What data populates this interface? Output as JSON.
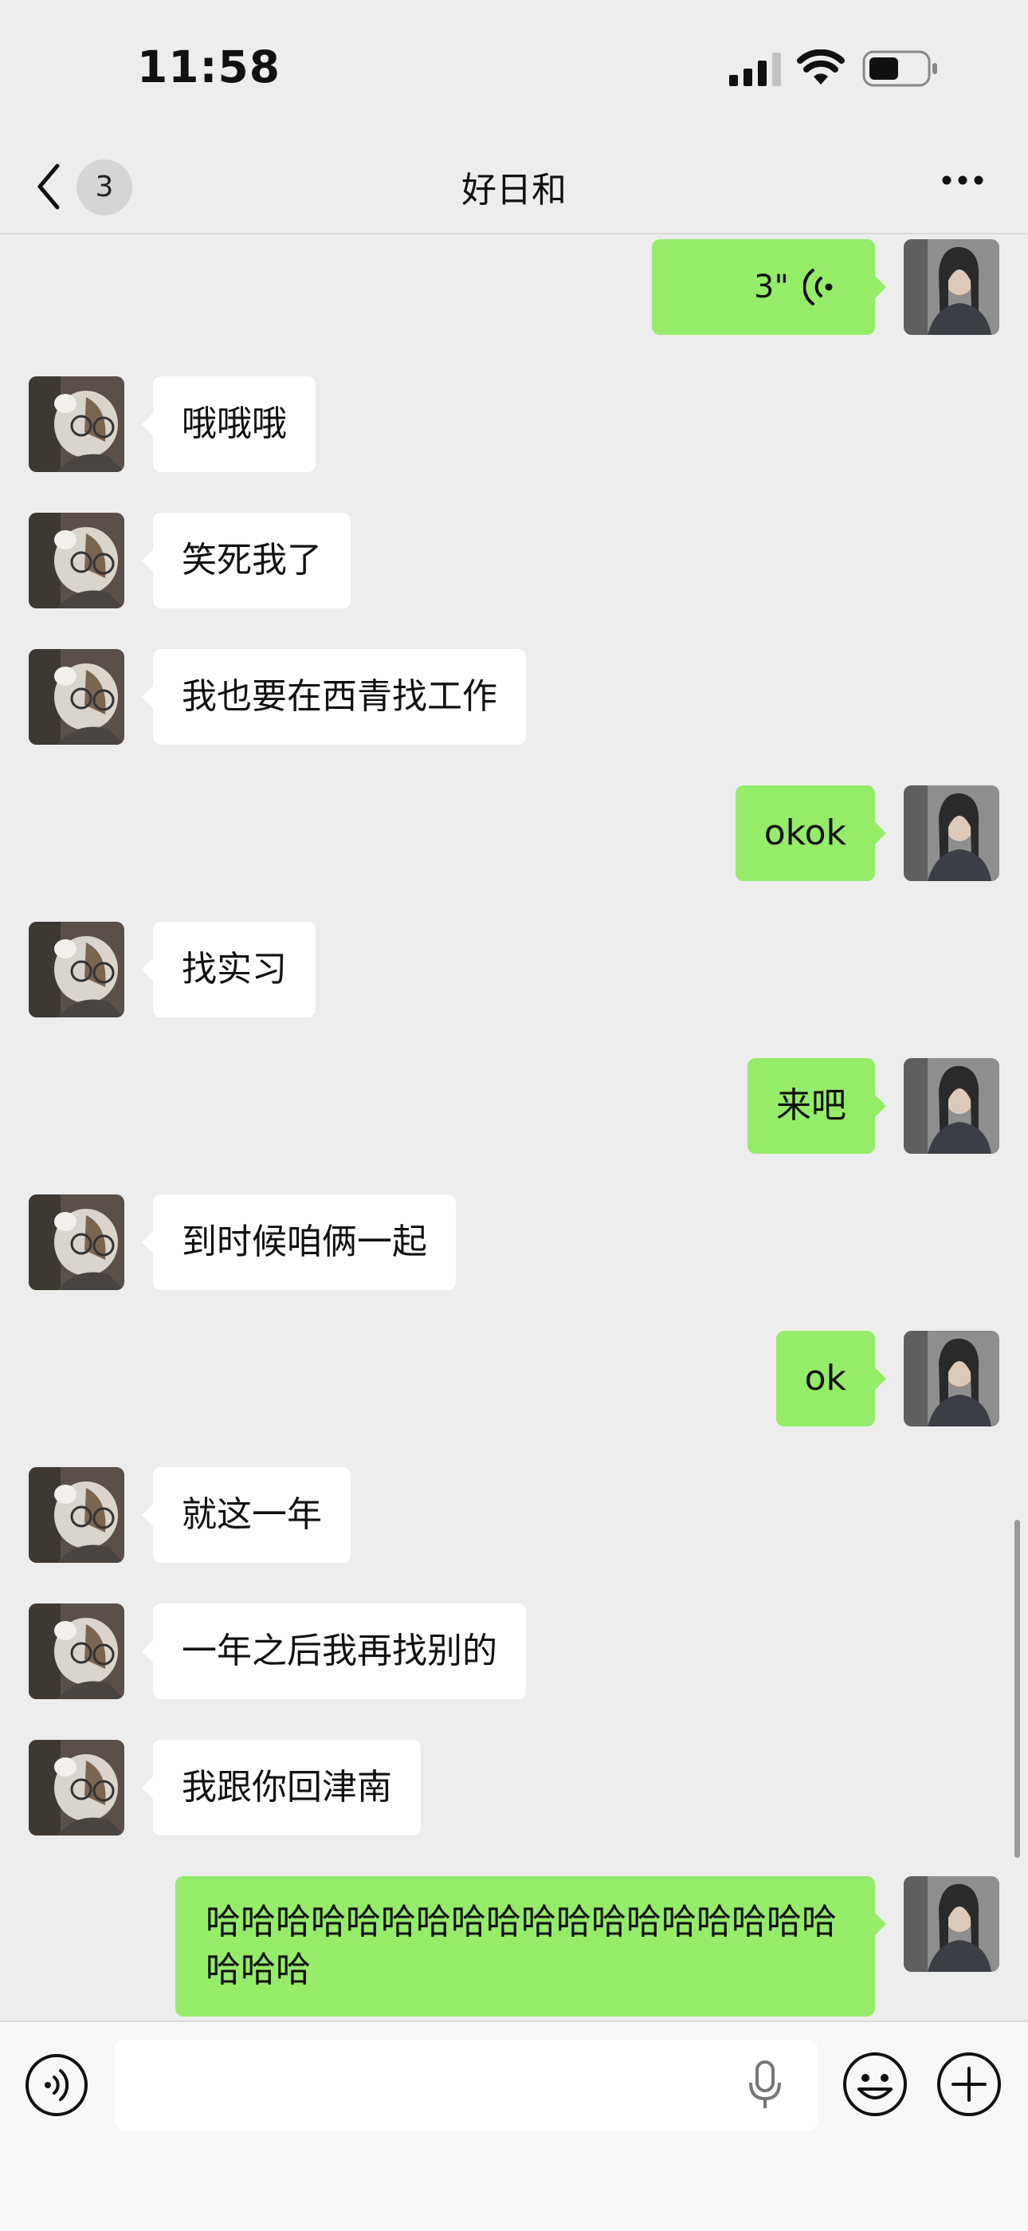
{
  "status_bar": {
    "time": "11:58"
  },
  "nav": {
    "unread_count": "3",
    "title": "好日和"
  },
  "messages": [
    {
      "side": "out",
      "type": "voice",
      "duration": "3\""
    },
    {
      "side": "in",
      "text": "哦哦哦"
    },
    {
      "side": "in",
      "text": "笑死我了"
    },
    {
      "side": "in",
      "text": "我也要在西青找工作"
    },
    {
      "side": "out",
      "text": "okok"
    },
    {
      "side": "in",
      "text": "找实习"
    },
    {
      "side": "out",
      "text": "来吧"
    },
    {
      "side": "in",
      "text": "到时候咱俩一起"
    },
    {
      "side": "out",
      "text": "ok"
    },
    {
      "side": "in",
      "text": "就这一年"
    },
    {
      "side": "in",
      "text": "一年之后我再找别的"
    },
    {
      "side": "in",
      "text": "我跟你回津南"
    },
    {
      "side": "out",
      "text": "哈哈哈哈哈哈哈哈哈哈哈哈哈哈哈哈哈哈哈哈哈"
    }
  ],
  "input": {
    "placeholder": ""
  },
  "colors": {
    "outgoing_bubble": "#95ec69",
    "incoming_bubble": "#ffffff",
    "background": "#ededed"
  },
  "icons": [
    "back-chevron-icon",
    "more-dots-icon",
    "voice-wave-icon",
    "voice-input-icon",
    "mic-icon",
    "emoji-icon",
    "plus-icon",
    "signal-icon",
    "wifi-icon",
    "battery-icon"
  ]
}
